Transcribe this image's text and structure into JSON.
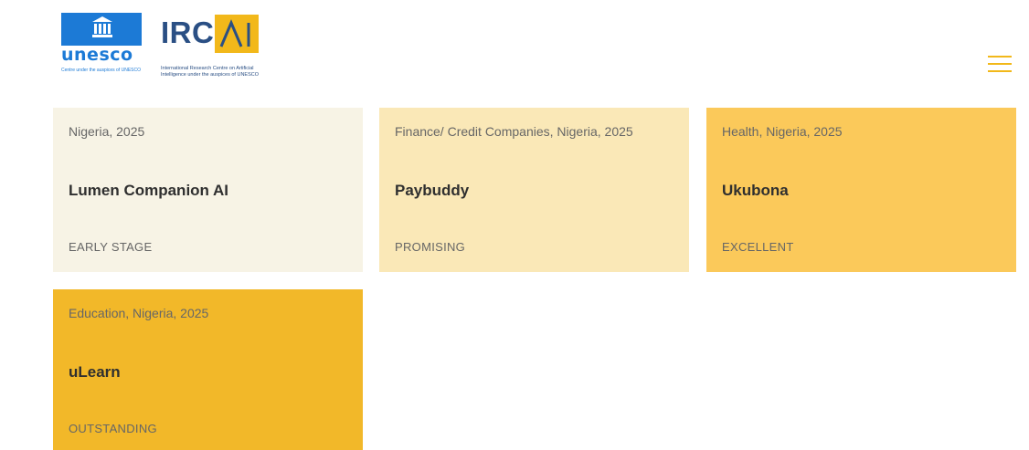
{
  "header": {
    "unesco": {
      "wordmark": "unesco",
      "subline": "Centre under the auspices of UNESCO"
    },
    "ircai": {
      "wordmark": "IRC",
      "ai_mark": "AI",
      "subline": "International Research Centre on Artificial Intelligence under the auspices of UNESCO"
    },
    "menu_icon": "hamburger-menu-icon",
    "colors": {
      "unesco_blue": "#1c7ad6",
      "irc_navy": "#2a4f84",
      "accent_yellow": "#f2b81a"
    }
  },
  "cards": [
    {
      "meta": "Nigeria, 2025",
      "title": "Lumen Companion AI",
      "rating": "EARLY STAGE",
      "bg": "#f7f3e5"
    },
    {
      "meta": "Finance/ Credit Companies, Nigeria, 2025",
      "title": "Paybuddy",
      "rating": "PROMISING",
      "bg": "#fae8b7"
    },
    {
      "meta": "Health, Nigeria, 2025",
      "title": "Ukubona",
      "rating": "EXCELLENT",
      "bg": "#fbc95a"
    },
    {
      "meta": "Education, Nigeria, 2025",
      "title": "uLearn",
      "rating": "OUTSTANDING",
      "bg": "#f2b829"
    }
  ]
}
